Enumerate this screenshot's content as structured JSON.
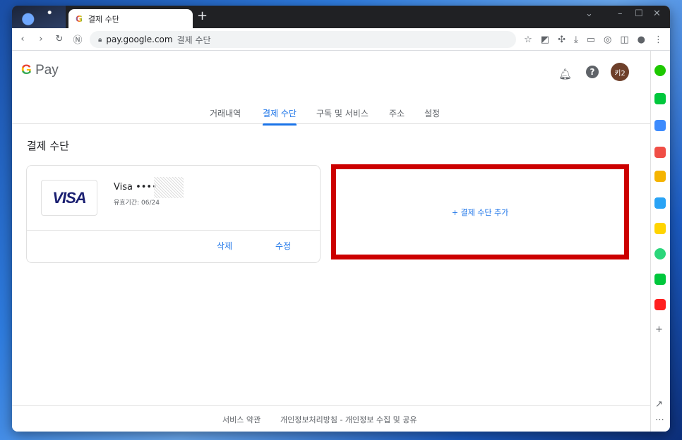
{
  "browser": {
    "tab_title": "결제 수단",
    "tab_icon": "G",
    "new_tab": "+",
    "url": "pay.google.com",
    "url_title": "결제 수단"
  },
  "header": {
    "logo_g": "G",
    "logo_text": "Pay",
    "avatar_text": "키2"
  },
  "nav": {
    "tabs": [
      {
        "label": "거래내역"
      },
      {
        "label": "결제 수단"
      },
      {
        "label": "구독 및 서비스"
      },
      {
        "label": "주소"
      },
      {
        "label": "설정"
      }
    ]
  },
  "main": {
    "title": "결제 수단",
    "card": {
      "brand": "VISA",
      "name": "Visa ••••",
      "expiry": "유효기간: 06/24",
      "delete_label": "삭제",
      "edit_label": "수정"
    },
    "add_label": "+ 결제 수단 추가"
  },
  "footer": {
    "terms": "서비스 약관",
    "privacy": "개인정보처리방침 - 개인정보 수집 및 공유"
  },
  "colors": {
    "accent": "#1a73e8",
    "highlight": "#cc0000"
  }
}
